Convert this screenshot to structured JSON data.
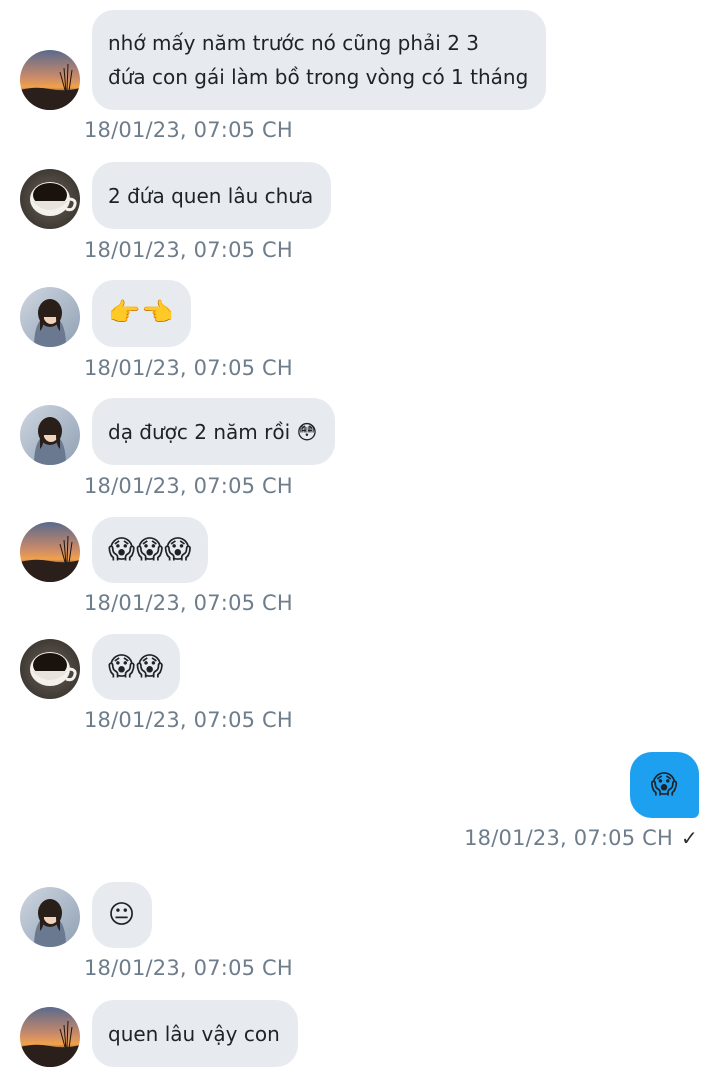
{
  "messages": [
    {
      "sender": "sunset",
      "text_line1": "nhớ mấy năm trước nó cũng phải 2 3",
      "text_line2": "đứa con gái làm bồ trong vòng có 1 tháng",
      "time": "18/01/23,  07:05 CH"
    },
    {
      "sender": "coffee",
      "text": "2 đứa quen lâu chưa",
      "time": "18/01/23,  07:05 CH"
    },
    {
      "sender": "girl",
      "text": "👉👈",
      "time": "18/01/23,  07:05 CH"
    },
    {
      "sender": "girl",
      "text": "dạ được 2 năm rồi 😳",
      "time": "18/01/23,  07:05 CH"
    },
    {
      "sender": "sunset",
      "text": "😱😱😱",
      "time": "18/01/23,  07:05 CH"
    },
    {
      "sender": "coffee",
      "text": "😱😱",
      "time": "18/01/23,  07:05 CH"
    },
    {
      "sender": "me",
      "text": "😱",
      "time": "18/01/23,  07:05 CH",
      "status": "✓"
    },
    {
      "sender": "girl",
      "text": "😐",
      "time": "18/01/23,  07:05 CH"
    },
    {
      "sender": "sunset",
      "text": "quen lâu vậy con"
    }
  ],
  "colors": {
    "incoming_bubble": "#e7ebef",
    "outgoing_bubble": "#1ea0f0",
    "timestamp": "#6e7d8c"
  },
  "avatars": {
    "sunset": "sunset-field-avatar",
    "coffee": "coffee-cup-avatar",
    "girl": "girl-portrait-avatar"
  }
}
